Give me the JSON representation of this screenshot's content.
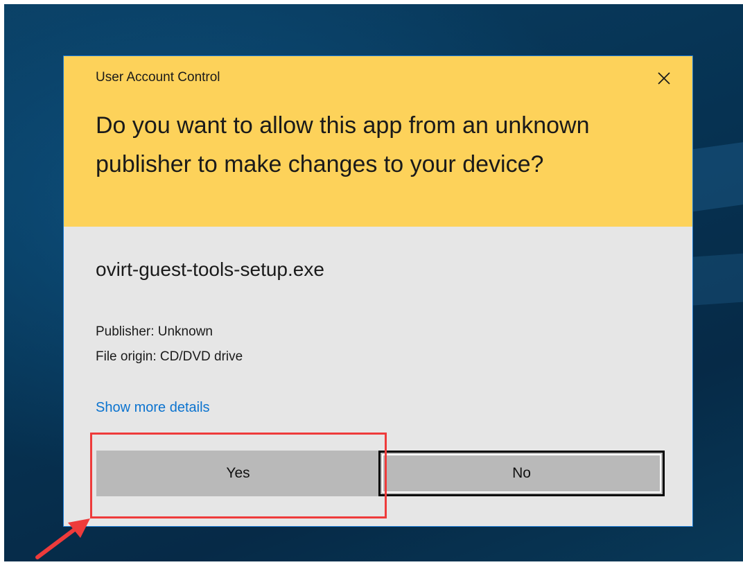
{
  "dialog": {
    "title": "User Account Control",
    "question": "Do you want to allow this app from an unknown publisher to make changes to your device?",
    "filename": "ovirt-guest-tools-setup.exe",
    "publisher": "Publisher: Unknown",
    "origin": "File origin: CD/DVD drive",
    "details_link": "Show more details",
    "yes_label": "Yes",
    "no_label": "No",
    "close_icon": "close-icon"
  },
  "colors": {
    "header": "#fdd25a",
    "body": "#e6e6e6",
    "link": "#0b73cf",
    "button": "#b9b9b9",
    "annotation": "#ee3b3b",
    "desktop": "#063252"
  },
  "annotation": {
    "highlight_target": "yes-button",
    "arrow_icon": "red-arrow-icon"
  }
}
